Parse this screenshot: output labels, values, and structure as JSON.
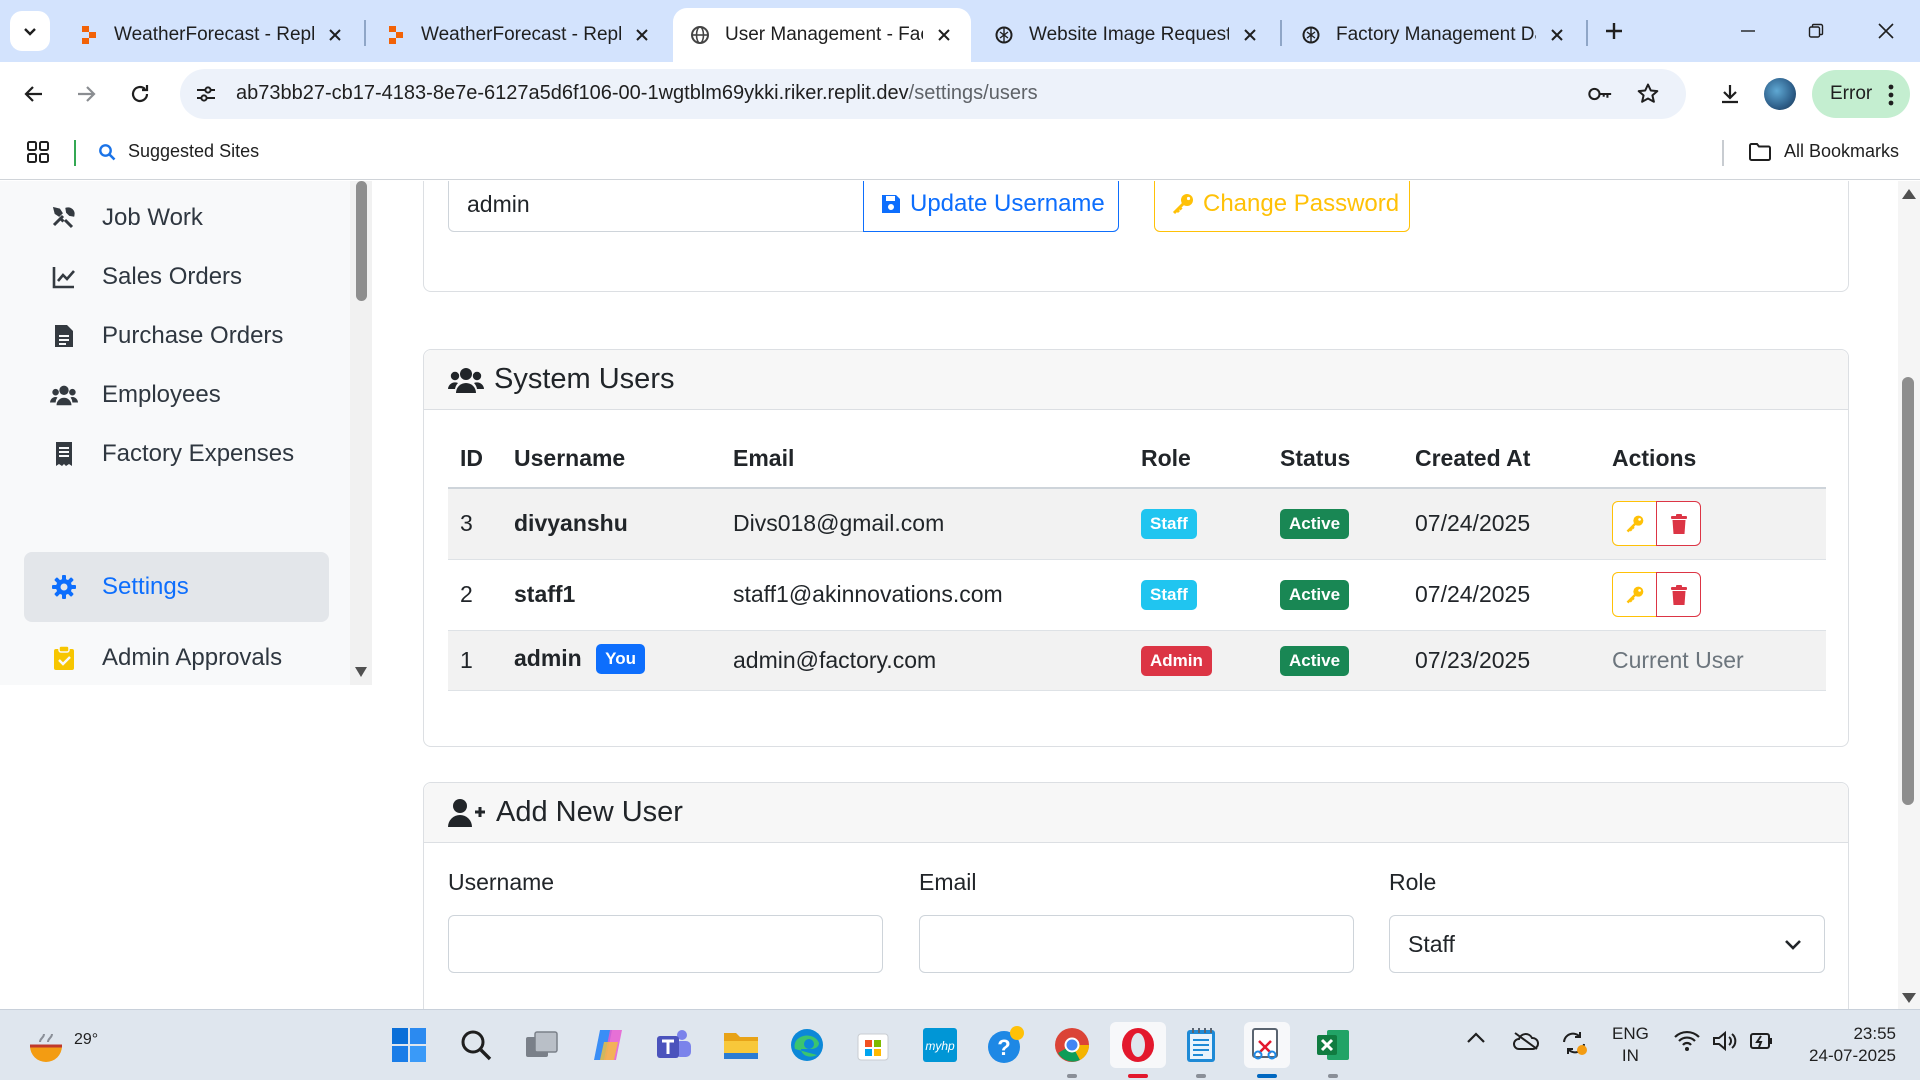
{
  "browser": {
    "tabs": [
      {
        "title": "WeatherForecast - Replit",
        "favicon": "replit-icon",
        "active": false
      },
      {
        "title": "WeatherForecast - Replit",
        "favicon": "replit-icon",
        "active": false
      },
      {
        "title": "User Management - Factory Management",
        "favicon": "globe-icon",
        "active": true
      },
      {
        "title": "Website Image Request",
        "favicon": "chatgpt-icon",
        "active": false
      },
      {
        "title": "Factory Management Dashboard",
        "favicon": "chatgpt-icon",
        "active": false
      }
    ],
    "url_host": "ab73bb27-cb17-4183-8e7e-6127a5d6f106-00-1wgtblm69ykki.riker.replit.dev",
    "url_path": "/settings/users",
    "profile_status": "Error",
    "bookmarks": {
      "suggested": "Suggested Sites",
      "all": "All Bookmarks"
    }
  },
  "sidebar": {
    "items": [
      {
        "label": "Job Work",
        "icon": "tools-icon"
      },
      {
        "label": "Sales Orders",
        "icon": "chart-line-icon"
      },
      {
        "label": "Purchase Orders",
        "icon": "file-icon"
      },
      {
        "label": "Employees",
        "icon": "users-icon"
      },
      {
        "label": "Factory Expenses",
        "icon": "receipt-icon"
      },
      {
        "label": "Settings",
        "icon": "gear-icon",
        "active": true
      },
      {
        "label": "Admin Approvals",
        "icon": "clipboard-check-icon"
      }
    ]
  },
  "account": {
    "username_value": "admin",
    "update_username_label": "Update Username",
    "change_password_label": "Change Password"
  },
  "system_users": {
    "title": "System Users",
    "columns": [
      "ID",
      "Username",
      "Email",
      "Role",
      "Status",
      "Created At",
      "Actions"
    ],
    "rows": [
      {
        "id": "3",
        "username": "divyanshu",
        "email": "Divs018@gmail.com",
        "role": "Staff",
        "status": "Active",
        "created": "07/24/2025"
      },
      {
        "id": "2",
        "username": "staff1",
        "email": "staff1@akinnovations.com",
        "role": "Staff",
        "status": "Active",
        "created": "07/24/2025"
      },
      {
        "id": "1",
        "username": "admin",
        "you_badge": "You",
        "email": "admin@factory.com",
        "role": "Admin",
        "status": "Active",
        "created": "07/23/2025",
        "action_text": "Current User"
      }
    ]
  },
  "add_user": {
    "title": "Add New User",
    "username_label": "Username",
    "email_label": "Email",
    "role_label": "Role",
    "role_selected": "Staff"
  },
  "taskbar": {
    "temperature": "29°",
    "lang_line1": "ENG",
    "lang_line2": "IN",
    "time": "23:55",
    "date": "24-07-2025"
  },
  "colors": {
    "primary": "#0d6efd",
    "warning": "#ffc107",
    "danger": "#dc3545",
    "success": "#198754",
    "info": "#20c5f0"
  }
}
